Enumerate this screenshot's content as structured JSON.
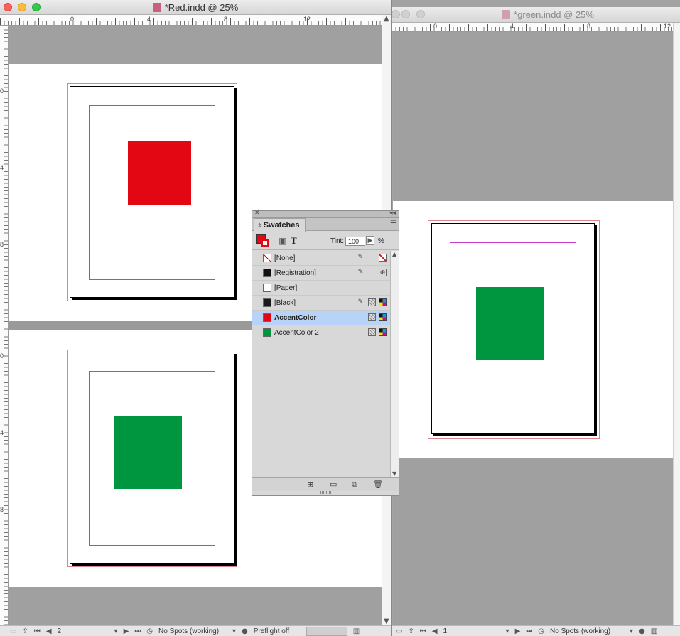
{
  "windows": {
    "red": {
      "title": "*Red.indd @ 25%",
      "ruler_labels": [
        "0",
        "4",
        "8",
        "12"
      ],
      "vruler_labels": [
        "0",
        "4",
        "8",
        "0",
        "4",
        "8"
      ],
      "status": {
        "page": "2",
        "spots": "No Spots (working)",
        "preflight": "Preflight off"
      },
      "squares": [
        "#e30613",
        "#009640"
      ]
    },
    "green": {
      "title": "*green.indd @ 25%",
      "ruler_labels": [
        "0",
        "4",
        "8",
        "12"
      ],
      "status": {
        "page": "1",
        "spots": "No Spots (working)"
      },
      "squares": [
        "#009640"
      ]
    }
  },
  "swatches": {
    "tab_label": "Swatches",
    "tint_label": "Tint:",
    "tint_value": "100",
    "percent": "%",
    "text_icon": "T",
    "items": [
      {
        "name": "[None]",
        "color": "none",
        "selected": false
      },
      {
        "name": "[Registration]",
        "color": "#111111",
        "selected": false
      },
      {
        "name": "[Paper]",
        "color": "#ffffff",
        "selected": false
      },
      {
        "name": "[Black]",
        "color": "#1a1a1a",
        "selected": false
      },
      {
        "name": "AccentColor",
        "color": "#e30613",
        "selected": true
      },
      {
        "name": "AccentColor 2",
        "color": "#009640",
        "selected": false
      }
    ]
  }
}
